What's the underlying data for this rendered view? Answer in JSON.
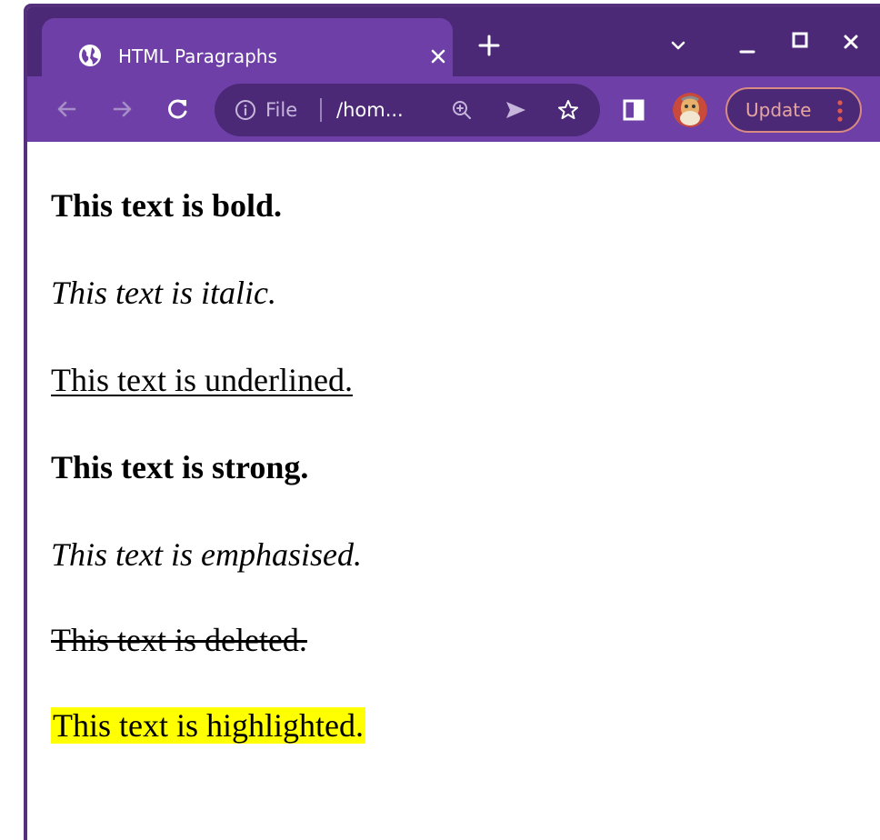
{
  "tab": {
    "title": "HTML Paragraphs",
    "favicon": "globe-icon"
  },
  "toolbar": {
    "scheme": "File",
    "url": "/hom...",
    "update_label": "Update"
  },
  "colors": {
    "frame": "#4b2977",
    "toolbar": "#6d3fa7",
    "highlight": "#ffff00",
    "update_accent": "#e6a69f"
  },
  "content": {
    "bold": "This text is bold.",
    "italic": "This text is italic.",
    "underlined": "This text is underlined.",
    "strong": "This text is strong.",
    "emphasised": "This text is emphasised.",
    "deleted": "This text is deleted.",
    "highlighted": "This text is highlighted."
  }
}
